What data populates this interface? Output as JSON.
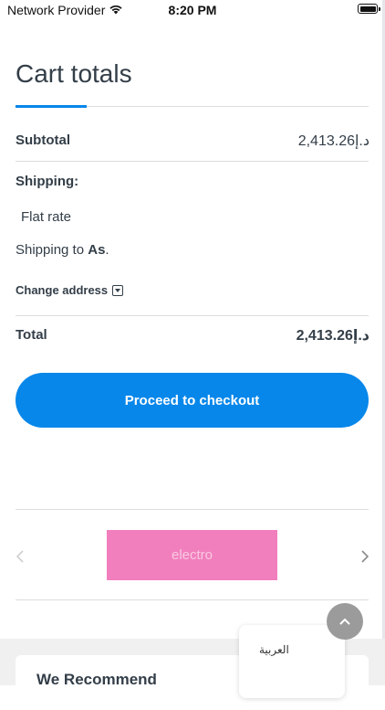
{
  "status_bar": {
    "carrier": "Network Provider",
    "time": "8:20 PM"
  },
  "cart_totals": {
    "title": "Cart totals",
    "subtotal_label": "Subtotal",
    "subtotal_value": "2,413.26د.إ",
    "shipping_label": "Shipping:",
    "shipping_method": "Flat rate",
    "shipping_to_prefix": "Shipping to ",
    "shipping_to_place": "As",
    "shipping_to_suffix": ".",
    "change_address": "Change address",
    "total_label": "Total",
    "total_value": "2,413.26د.إ",
    "checkout_button": "Proceed to checkout"
  },
  "brand_carousel": {
    "brand_name": "electro"
  },
  "recommend": {
    "title": "We Recommend"
  },
  "language_switcher": {
    "label": "العربية"
  },
  "colors": {
    "accent": "#0787ea",
    "brand_box": "#f17fbd"
  }
}
